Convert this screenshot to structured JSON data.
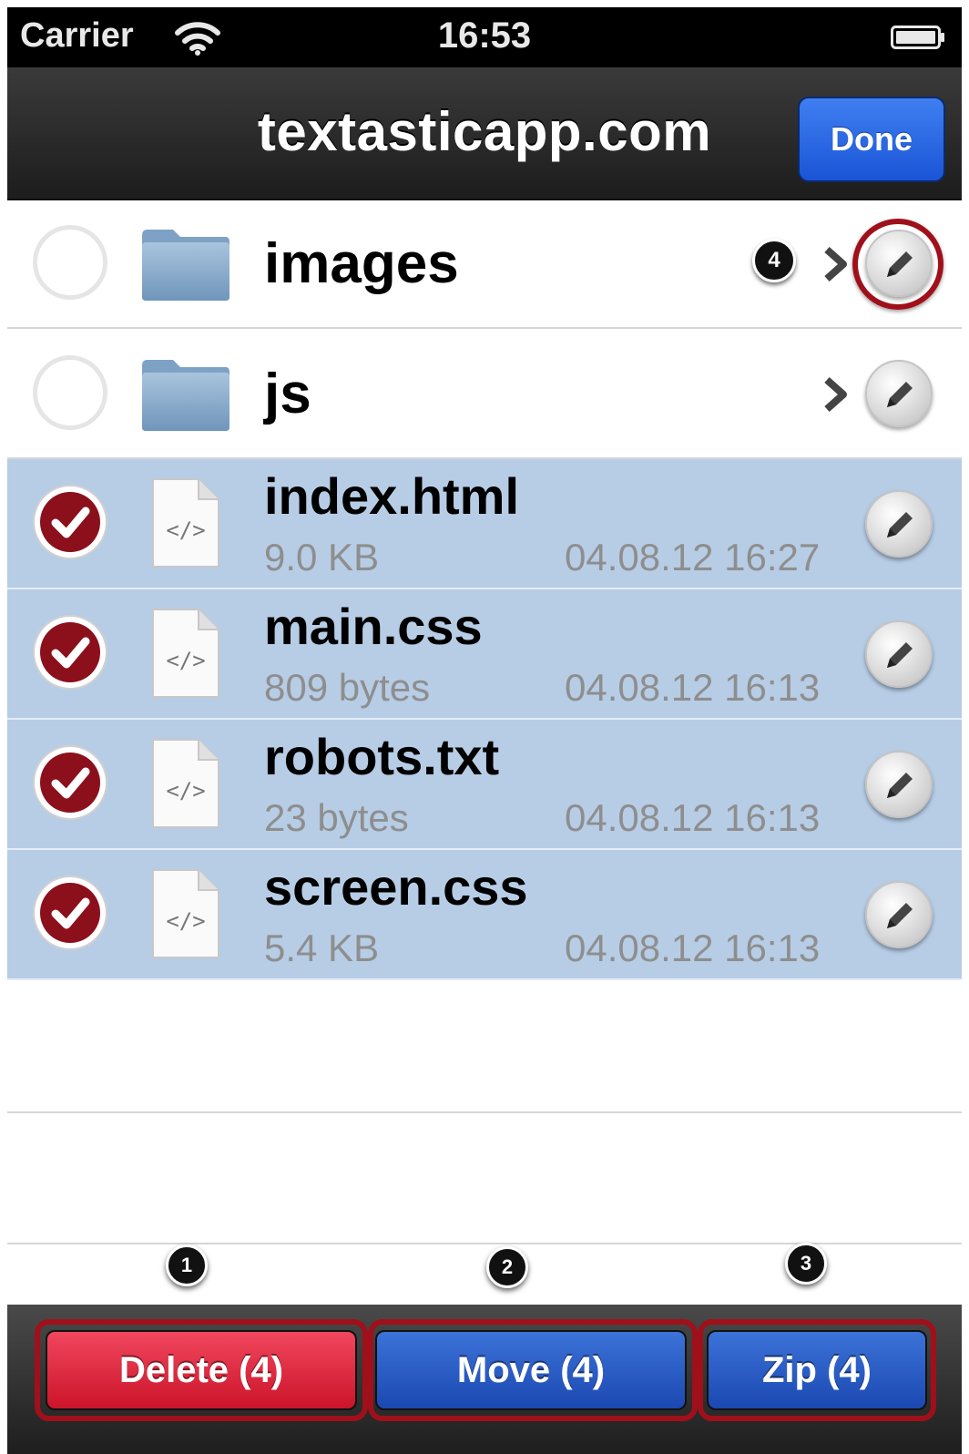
{
  "status_bar": {
    "carrier": "Carrier",
    "time": "16:53"
  },
  "nav": {
    "title": "textasticapp.com",
    "done_label": "Done"
  },
  "folders": [
    {
      "name": "images",
      "badge": "4"
    },
    {
      "name": "js"
    }
  ],
  "files": [
    {
      "name": "index.html",
      "size": "9.0 KB",
      "date": "04.08.12 16:27",
      "selected": true
    },
    {
      "name": "main.css",
      "size": "809 bytes",
      "date": "04.08.12 16:13",
      "selected": true
    },
    {
      "name": "robots.txt",
      "size": "23 bytes",
      "date": "04.08.12 16:13",
      "selected": true
    },
    {
      "name": "screen.css",
      "size": "5.4 KB",
      "date": "04.08.12 16:13",
      "selected": true
    }
  ],
  "callouts": [
    "1",
    "2",
    "3"
  ],
  "toolbar": {
    "delete_label": "Delete (4)",
    "move_label": "Move (4)",
    "zip_label": "Zip (4)"
  },
  "colors": {
    "selection": "#b7cde6",
    "highlight_ring": "#a0101a",
    "delete": "#d81e34",
    "accent_blue": "#1f55c8"
  },
  "icons": {
    "folder": "folder-icon",
    "file": "code-file-icon",
    "edit": "pencil-icon",
    "disclosure": "chevron-right-icon",
    "check": "checkmark-icon"
  }
}
